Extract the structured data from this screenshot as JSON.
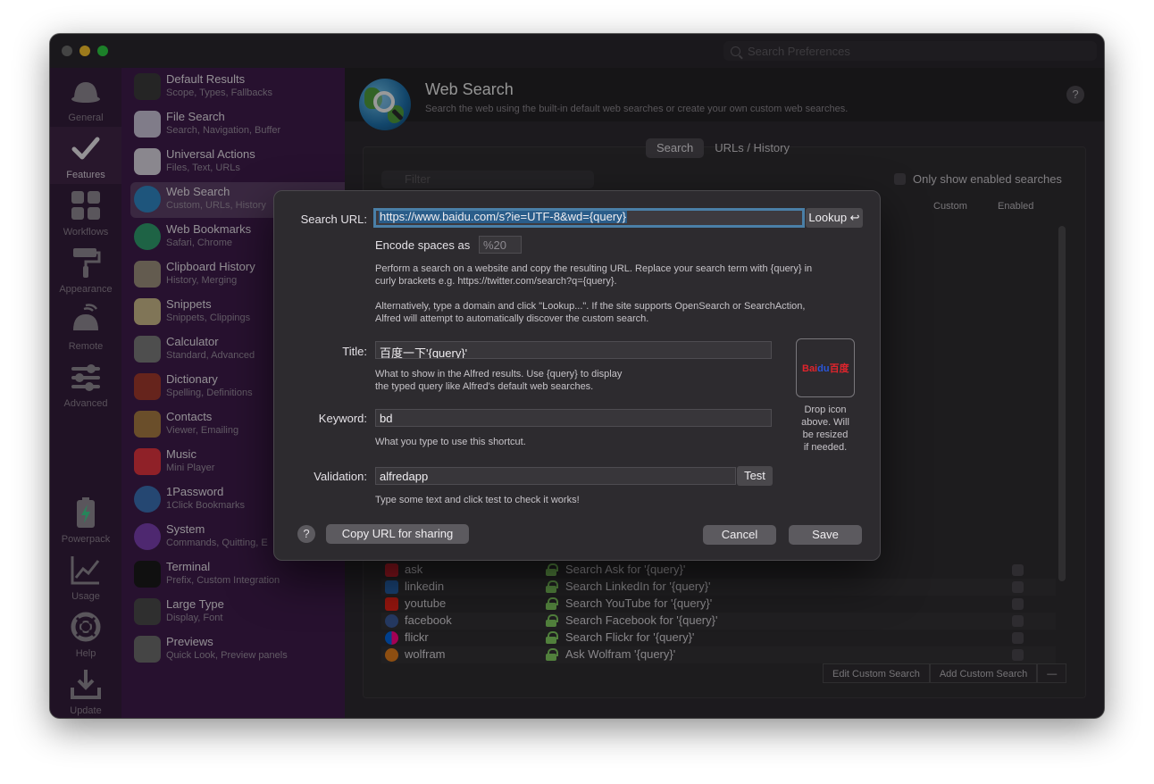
{
  "window": {
    "search_placeholder": "Search Preferences"
  },
  "iconbar": [
    {
      "label": "General",
      "icon": "hat-icon"
    },
    {
      "label": "Features",
      "icon": "checkmark-icon"
    },
    {
      "label": "Workflows",
      "icon": "grid-icon"
    },
    {
      "label": "Appearance",
      "icon": "paint-roller-icon"
    },
    {
      "label": "Remote",
      "icon": "remote-icon"
    },
    {
      "label": "Advanced",
      "icon": "sliders-icon"
    },
    {
      "label": "Powerpack",
      "icon": "battery-icon"
    },
    {
      "label": "Usage",
      "icon": "chart-icon"
    },
    {
      "label": "Help",
      "icon": "lifebuoy-icon"
    },
    {
      "label": "Update",
      "icon": "download-icon"
    }
  ],
  "sidebar": [
    {
      "title": "Default Results",
      "sub": "Scope, Types, Fallbacks",
      "color": "#3a3a3a"
    },
    {
      "title": "File Search",
      "sub": "Search, Navigation, Buffer",
      "color": "#c9c3d6"
    },
    {
      "title": "Universal Actions",
      "sub": "Files, Text, URLs",
      "color": "#d8d3de"
    },
    {
      "title": "Web Search",
      "sub": "Custom, URLs, History",
      "color": "#2f86c2"
    },
    {
      "title": "Web Bookmarks",
      "sub": "Safari, Chrome",
      "color": "#2f9c6d"
    },
    {
      "title": "Clipboard History",
      "sub": "History, Merging",
      "color": "#9c8f7c"
    },
    {
      "title": "Snippets",
      "sub": "Snippets, Clippings",
      "color": "#c9b888"
    },
    {
      "title": "Calculator",
      "sub": "Standard, Advanced",
      "color": "#7a7a7a"
    },
    {
      "title": "Dictionary",
      "sub": "Spelling, Definitions",
      "color": "#a0392d"
    },
    {
      "title": "Contacts",
      "sub": "Viewer, Emailing",
      "color": "#a77a42"
    },
    {
      "title": "Music",
      "sub": "Mini Player",
      "color": "#e0353f"
    },
    {
      "title": "1Password",
      "sub": "1Click Bookmarks",
      "color": "#3a6fb3"
    },
    {
      "title": "System",
      "sub": "Commands, Quitting, E",
      "color": "#7b3fb0"
    },
    {
      "title": "Terminal",
      "sub": "Prefix, Custom Integration",
      "color": "#1a1a1a"
    },
    {
      "title": "Large Type",
      "sub": "Display, Font",
      "color": "#4a4a4a"
    },
    {
      "title": "Previews",
      "sub": "Quick Look, Preview panels",
      "color": "#6c6c6c"
    }
  ],
  "main": {
    "title": "Web Search",
    "description": "Search the web using the built-in default web searches or create your own custom web searches.",
    "help": "?",
    "tabs": [
      "Search",
      "URLs / History"
    ],
    "filter_placeholder": "Filter",
    "only_enabled_label": "Only show enabled searches",
    "columns": {
      "custom": "Custom",
      "enabled": "Enabled"
    },
    "rows": [
      {
        "keyword": "ask",
        "text": "Search Ask for '{query}'",
        "icon_color": "#d3202e"
      },
      {
        "keyword": "linkedin",
        "text": "Search LinkedIn for '{query}'",
        "icon_color": "#2867b2"
      },
      {
        "keyword": "youtube",
        "text": "Search YouTube for '{query}'",
        "icon_color": "#e62117"
      },
      {
        "keyword": "facebook",
        "text": "Search Facebook for '{query}'",
        "icon_color": "#3b5998"
      },
      {
        "keyword": "flickr",
        "text": "Search Flickr for '{query}'",
        "icon_color": "#0063dc"
      },
      {
        "keyword": "wolfram",
        "text": "Ask Wolfram '{query}'",
        "icon_color": "#dd7a1c"
      }
    ],
    "buttons": {
      "edit": "Edit Custom Search",
      "add": "Add Custom Search",
      "remove": "—"
    }
  },
  "dialog": {
    "search_url_label": "Search URL:",
    "search_url_value": "https://www.baidu.com/s?ie=UTF-8&wd={query}",
    "lookup_label": "Lookup ↩",
    "encode_label": "Encode spaces as",
    "encode_value": "%20",
    "help1_line1": "Perform a search on a website and copy the resulting URL. Replace your search term with {query} in",
    "help1_line2": "curly brackets e.g. https://twitter.com/search?q={query}.",
    "help2_line1": "Alternatively, type a domain and click \"Lookup...\". If the site supports OpenSearch or SearchAction,",
    "help2_line2": "Alfred will attempt to automatically discover the custom search.",
    "title_label": "Title:",
    "title_value": "百度一下'{query}'",
    "title_help1": "What to show in the Alfred results. Use {query} to display",
    "title_help2": "the typed query like Alfred's default web searches.",
    "keyword_label": "Keyword:",
    "keyword_value": "bd",
    "keyword_help": "What you type to use this shortcut.",
    "validation_label": "Validation:",
    "validation_value": "alfredapp",
    "test_label": "Test",
    "validation_help": "Type some text and click test to check it works!",
    "icon_logo_left": "Bai",
    "icon_logo_mid": "du",
    "icon_logo_right": "百度",
    "drop_text1": "Drop icon",
    "drop_text2": "above. Will",
    "drop_text3": "be resized",
    "drop_text4": "if needed.",
    "help_button": "?",
    "copy_url_label": "Copy URL for sharing",
    "cancel_label": "Cancel",
    "save_label": "Save"
  }
}
